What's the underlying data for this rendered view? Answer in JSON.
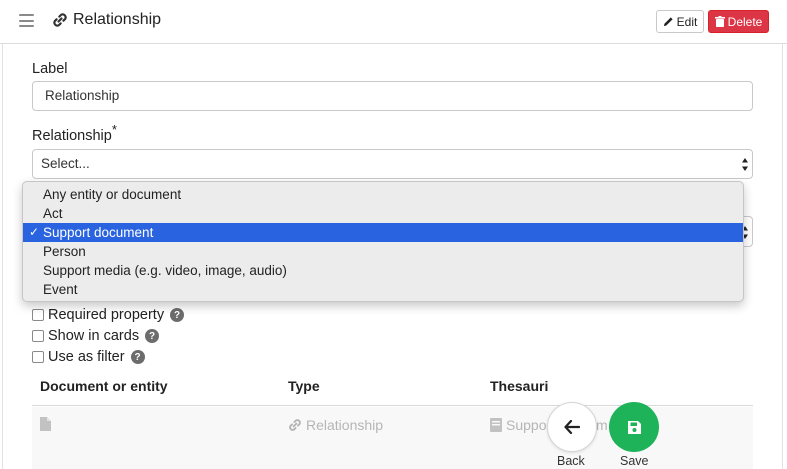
{
  "header": {
    "title": "Relationship",
    "edit_label": "Edit",
    "delete_label": "Delete"
  },
  "form": {
    "label_caption": "Label",
    "label_value": "Relationship",
    "relationship_caption": "Relationship",
    "required_marker": "*",
    "relationship_select_value": "Select..."
  },
  "dropdown": {
    "options": [
      "Any entity or document",
      "Act",
      "Support document",
      "Person",
      "Support media (e.g. video, image, audio)",
      "Event"
    ],
    "selected": "Support document",
    "check_mark": "✓"
  },
  "checkboxes": [
    {
      "label": "Required property",
      "checked": false
    },
    {
      "label": "Show in cards",
      "checked": false
    },
    {
      "label": "Use as filter",
      "checked": false
    }
  ],
  "help_glyph": "?",
  "table": {
    "headers": [
      "Document or entity",
      "Type",
      "Thesauri"
    ],
    "row": {
      "type": "Relationship",
      "thesauri_partial": "Suppo",
      "thesauri_tail": "m"
    }
  },
  "actions": {
    "back_label": "Back",
    "save_label": "Save"
  },
  "colors": {
    "delete": "#dc3545",
    "save": "#1eb259",
    "selected_option": "#2a63e0"
  },
  "icons": {
    "menu": "hamburger-icon",
    "title": "link-icon",
    "edit": "pencil-icon",
    "delete": "trash-icon",
    "doc": "file-icon",
    "type": "link-icon",
    "thesauri": "book-icon",
    "back": "arrow-left-icon",
    "save": "floppy-disk-icon"
  }
}
